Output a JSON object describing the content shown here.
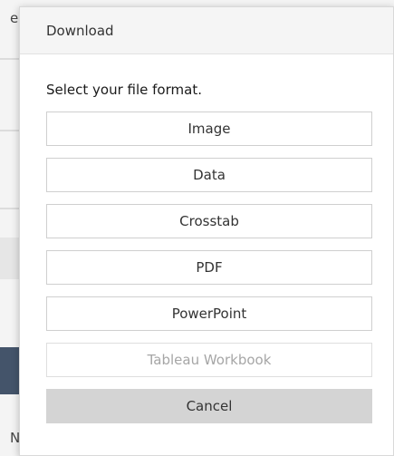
{
  "background": {
    "top_fragment": "e",
    "bottom_fragment": "N"
  },
  "dialog": {
    "title": "Download",
    "prompt": "Select your file format.",
    "formats": [
      {
        "label": "Image",
        "enabled": true
      },
      {
        "label": "Data",
        "enabled": true
      },
      {
        "label": "Crosstab",
        "enabled": true
      },
      {
        "label": "PDF",
        "enabled": true
      },
      {
        "label": "PowerPoint",
        "enabled": true
      },
      {
        "label": "Tableau Workbook",
        "enabled": false
      }
    ],
    "cancel_label": "Cancel"
  },
  "colors": {
    "header_bg": "#f5f5f5",
    "cancel_bg": "#d4d4d4",
    "disabled_text": "#a6a6a6",
    "background_dark_block": "#44546a"
  }
}
